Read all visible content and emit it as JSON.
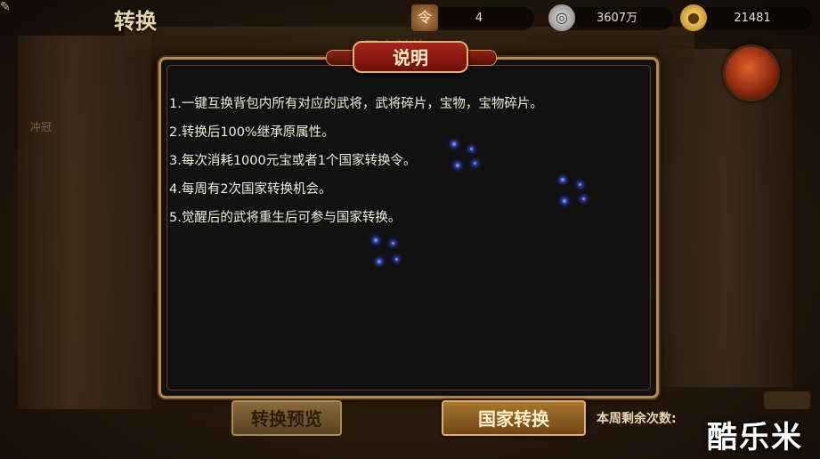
{
  "header": {
    "title": "转换",
    "corner_glyph": "✎",
    "behind_title": "国家转换",
    "side_text": "冲冠"
  },
  "resources": [
    {
      "icon": "token-icon",
      "value": "4"
    },
    {
      "icon": "silver-coin-icon",
      "value": "3607万"
    },
    {
      "icon": "gold-ingot-icon",
      "value": "21481"
    }
  ],
  "dialog": {
    "title": "说明",
    "lines": [
      "1.一键互换背包内所有对应的武将，武将碎片，宝物，宝物碎片。",
      "2.转换后100%继承原属性。",
      "3.每次消耗1000元宝或者1个国家转换令。",
      "4.每周有2次国家转换机会。",
      "5.觉醒后的武将重生后可参与国家转换。"
    ]
  },
  "footer": {
    "preview_button": "转换预览",
    "convert_button": "国家转换",
    "weekly_label": "本周剩余次数:"
  },
  "watermark": "酷乐米",
  "colors": {
    "dialog_bg": "#111111",
    "frame_gold": "#b58a4a",
    "header_red": "#a8241a",
    "text": "#f2ebdc"
  }
}
